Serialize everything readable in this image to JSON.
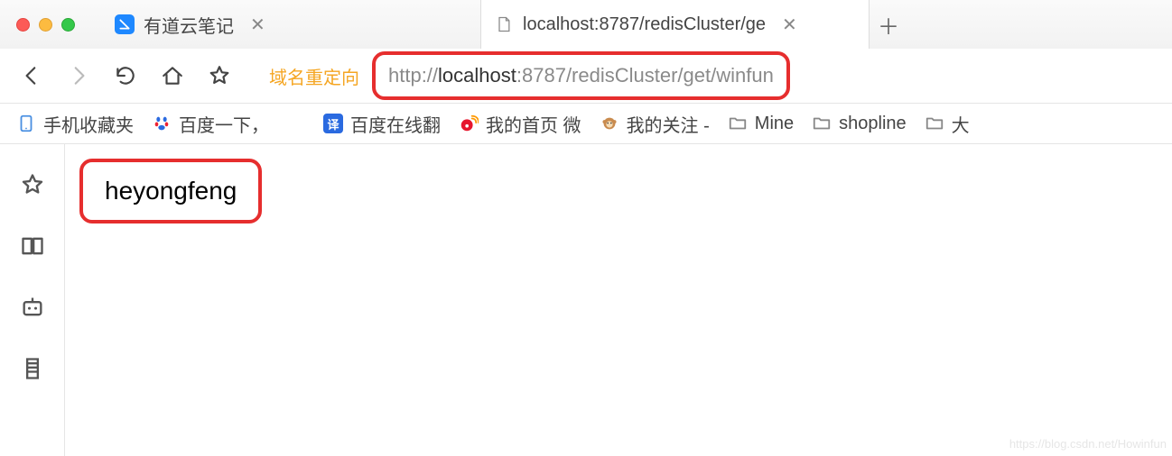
{
  "tabs": [
    {
      "title": "有道云笔记",
      "favicon": "youdao"
    },
    {
      "title": "localhost:8787/redisCluster/ge",
      "favicon": "page"
    }
  ],
  "address": {
    "redirect_label": "域名重定向",
    "scheme": "http://",
    "host": "localhost",
    "port_path": ":8787/redisCluster/get/winfun"
  },
  "bookmarks": [
    {
      "label": "手机收藏夹",
      "icon": "phone"
    },
    {
      "label": "百度一下，",
      "icon": "baidu"
    },
    {
      "label": "百度在线翻",
      "icon": "fanyi"
    },
    {
      "label": "我的首页 微",
      "icon": "weibo"
    },
    {
      "label": "我的关注 -",
      "icon": "monkey"
    },
    {
      "label": "Mine",
      "icon": "folder"
    },
    {
      "label": "shopline",
      "icon": "folder"
    },
    {
      "label": "大",
      "icon": "folder"
    }
  ],
  "page": {
    "body_text": "heyongfeng"
  },
  "watermark": "https://blog.csdn.net/Howinfun"
}
